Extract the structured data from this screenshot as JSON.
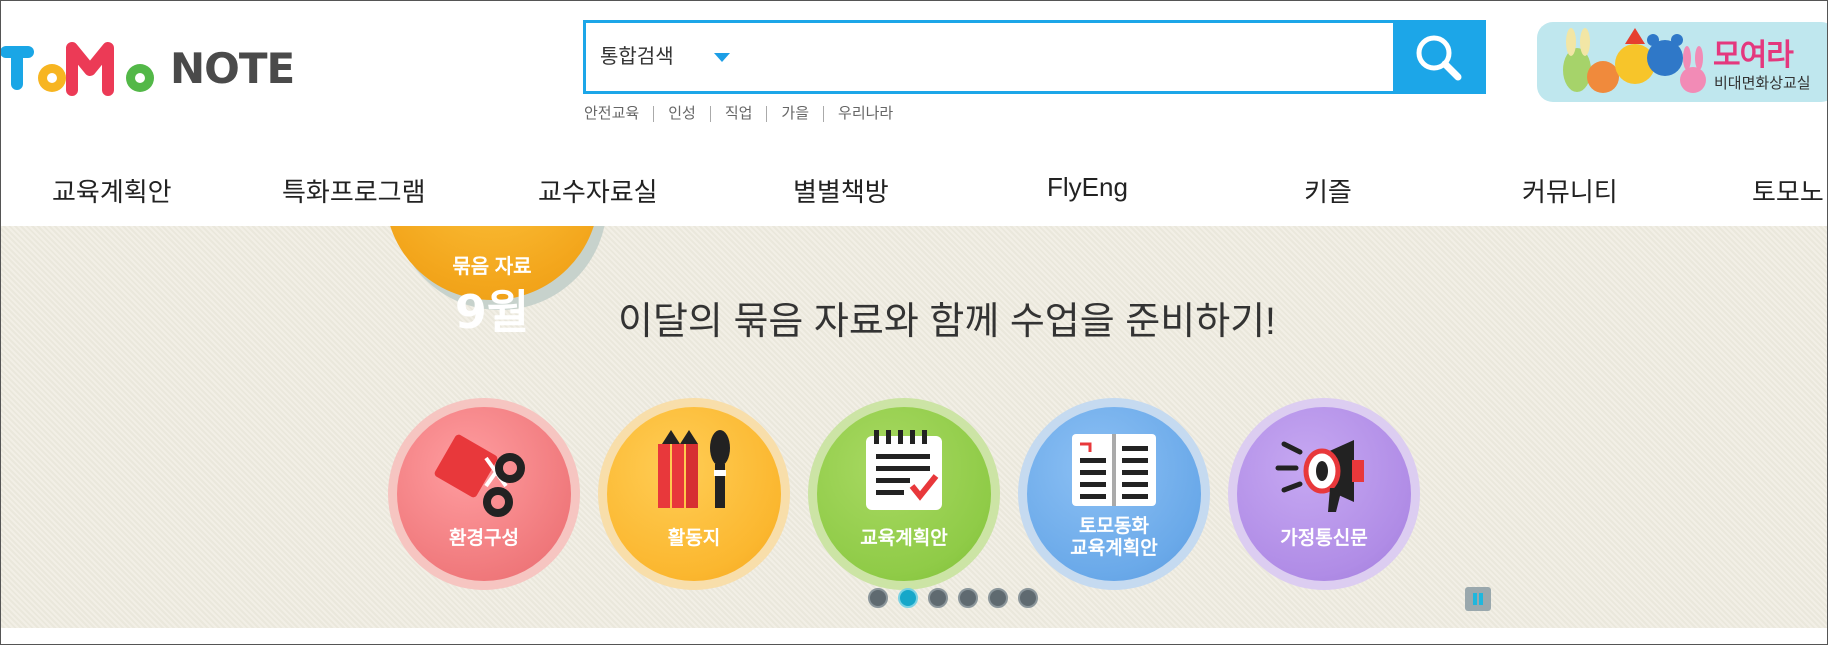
{
  "header": {
    "logo_text": "TOMO",
    "logo_note": "NOTE",
    "search": {
      "category": "통합검색",
      "placeholder": ""
    },
    "keywords": [
      "안전교육",
      "인성",
      "직업",
      "가을",
      "우리나라"
    ],
    "ad": {
      "title": "모여라",
      "subtitle": "비대면화상교실"
    }
  },
  "nav": {
    "items": [
      "교육계획안",
      "특화프로그램",
      "교수자료실",
      "별별책방",
      "FlyEng",
      "키즐",
      "커뮤니티",
      "토모노"
    ]
  },
  "main": {
    "month_label": "묶음 자료",
    "month_value": "9월",
    "headline": "이달의 묶음 자료와 함께 수업을 준비하기!",
    "categories": [
      {
        "label": "환경구성",
        "icon": "scissors-paper-icon",
        "color": "#f0797c"
      },
      {
        "label": "활동지",
        "icon": "pencil-brush-icon",
        "color": "#fbb72f"
      },
      {
        "label": "교육계획안",
        "icon": "notepad-check-icon",
        "color": "#8fcb47"
      },
      {
        "label_line1": "토모동화",
        "label_line2": "교육계획안",
        "icon": "open-book-icon",
        "color": "#6aa9e9"
      },
      {
        "label": "가정통신문",
        "icon": "megaphone-icon",
        "color": "#b08ce6"
      }
    ],
    "carousel": {
      "pages": 6,
      "active_page": 2
    }
  },
  "colors": {
    "accent": "#1ca6e8",
    "background": "#efece0"
  }
}
